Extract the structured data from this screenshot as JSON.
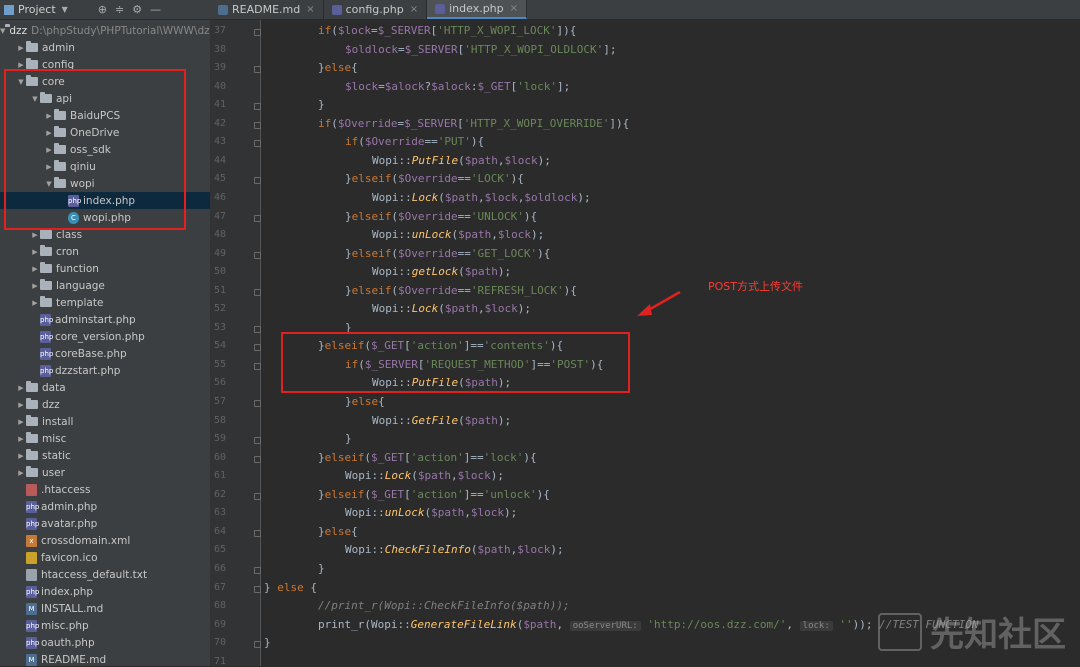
{
  "toolbar": {
    "project_label": "Project"
  },
  "tabs": [
    {
      "label": "README.md",
      "color": "#4d6e8f"
    },
    {
      "label": "config.php",
      "color": "#5a5f9a"
    },
    {
      "label": "index.php",
      "color": "#5a5f9a"
    }
  ],
  "root": {
    "name": "dzz",
    "path": "D:\\phpStudy\\PHPTutorial\\WWW\\dzz"
  },
  "tree": [
    {
      "label": "admin",
      "type": "folder",
      "depth": 1,
      "expanded": false
    },
    {
      "label": "config",
      "type": "folder",
      "depth": 1,
      "expanded": false
    },
    {
      "label": "core",
      "type": "folder",
      "depth": 1,
      "expanded": true
    },
    {
      "label": "api",
      "type": "folder",
      "depth": 2,
      "expanded": true
    },
    {
      "label": "BaiduPCS",
      "type": "folder",
      "depth": 3,
      "expanded": false
    },
    {
      "label": "OneDrive",
      "type": "folder",
      "depth": 3,
      "expanded": false
    },
    {
      "label": "oss_sdk",
      "type": "folder",
      "depth": 3,
      "expanded": false
    },
    {
      "label": "qiniu",
      "type": "folder",
      "depth": 3,
      "expanded": false
    },
    {
      "label": "wopi",
      "type": "folder",
      "depth": 3,
      "expanded": true
    },
    {
      "label": "index.php",
      "type": "php",
      "depth": 4,
      "selected": true
    },
    {
      "label": "wopi.php",
      "type": "class",
      "depth": 4
    },
    {
      "label": "class",
      "type": "folder",
      "depth": 2,
      "expanded": false
    },
    {
      "label": "cron",
      "type": "folder",
      "depth": 2,
      "expanded": false
    },
    {
      "label": "function",
      "type": "folder",
      "depth": 2,
      "expanded": false
    },
    {
      "label": "language",
      "type": "folder",
      "depth": 2,
      "expanded": false
    },
    {
      "label": "template",
      "type": "folder",
      "depth": 2,
      "expanded": false
    },
    {
      "label": "adminstart.php",
      "type": "php",
      "depth": 2
    },
    {
      "label": "core_version.php",
      "type": "php",
      "depth": 2
    },
    {
      "label": "coreBase.php",
      "type": "php",
      "depth": 2
    },
    {
      "label": "dzzstart.php",
      "type": "php",
      "depth": 2
    },
    {
      "label": "data",
      "type": "folder",
      "depth": 1,
      "expanded": false
    },
    {
      "label": "dzz",
      "type": "folder",
      "depth": 1,
      "expanded": false
    },
    {
      "label": "install",
      "type": "folder",
      "depth": 1,
      "expanded": false
    },
    {
      "label": "misc",
      "type": "folder",
      "depth": 1,
      "expanded": false
    },
    {
      "label": "static",
      "type": "folder",
      "depth": 1,
      "expanded": false
    },
    {
      "label": "user",
      "type": "folder",
      "depth": 1,
      "expanded": false
    },
    {
      "label": ".htaccess",
      "type": "ht",
      "depth": 1
    },
    {
      "label": "admin.php",
      "type": "php",
      "depth": 1
    },
    {
      "label": "avatar.php",
      "type": "php",
      "depth": 1
    },
    {
      "label": "crossdomain.xml",
      "type": "xml",
      "depth": 1
    },
    {
      "label": "favicon.ico",
      "type": "ico",
      "depth": 1
    },
    {
      "label": "htaccess_default.txt",
      "type": "txt",
      "depth": 1
    },
    {
      "label": "index.php",
      "type": "php",
      "depth": 1
    },
    {
      "label": "INSTALL.md",
      "type": "md",
      "depth": 1
    },
    {
      "label": "misc.php",
      "type": "php",
      "depth": 1
    },
    {
      "label": "oauth.php",
      "type": "php",
      "depth": 1
    },
    {
      "label": "README.md",
      "type": "md",
      "depth": 1
    }
  ],
  "code": [
    {
      "n": "37",
      "indent": 2,
      "t": [
        [
          "k",
          "if"
        ],
        [
          "p",
          "("
        ],
        [
          "v",
          "$lock"
        ],
        [
          "p",
          "="
        ],
        [
          "v",
          "$_SERVER"
        ],
        [
          "p",
          "["
        ],
        [
          "s",
          "'HTTP_X_WOPI_LOCK'"
        ],
        [
          "p",
          "]){"
        ]
      ]
    },
    {
      "n": "38",
      "indent": 3,
      "t": [
        [
          "v",
          "$oldlock"
        ],
        [
          "p",
          "="
        ],
        [
          "v",
          "$_SERVER"
        ],
        [
          "p",
          "["
        ],
        [
          "s",
          "'HTTP_X_WOPI_OLDLOCK'"
        ],
        [
          "p",
          "];"
        ]
      ]
    },
    {
      "n": "39",
      "indent": 2,
      "t": [
        [
          "p",
          "}"
        ],
        [
          "k",
          "else"
        ],
        [
          "p",
          "{"
        ]
      ]
    },
    {
      "n": "40",
      "indent": 3,
      "t": [
        [
          "v",
          "$lock"
        ],
        [
          "p",
          "="
        ],
        [
          "v",
          "$alock"
        ],
        [
          "p",
          "?"
        ],
        [
          "v",
          "$alock"
        ],
        [
          "p",
          ":"
        ],
        [
          "v",
          "$_GET"
        ],
        [
          "p",
          "["
        ],
        [
          "s",
          "'lock'"
        ],
        [
          "p",
          "];"
        ]
      ]
    },
    {
      "n": "41",
      "indent": 2,
      "t": [
        [
          "p",
          "}"
        ]
      ]
    },
    {
      "n": "42",
      "indent": 2,
      "t": [
        [
          "k",
          "if"
        ],
        [
          "p",
          "("
        ],
        [
          "v",
          "$Override"
        ],
        [
          "p",
          "="
        ],
        [
          "v",
          "$_SERVER"
        ],
        [
          "p",
          "["
        ],
        [
          "s",
          "'HTTP_X_WOPI_OVERRIDE'"
        ],
        [
          "p",
          "]){"
        ]
      ]
    },
    {
      "n": "43",
      "indent": 3,
      "t": [
        [
          "k",
          "if"
        ],
        [
          "p",
          "("
        ],
        [
          "v",
          "$Override"
        ],
        [
          "p",
          "=="
        ],
        [
          "s",
          "'PUT'"
        ],
        [
          "p",
          "){"
        ]
      ]
    },
    {
      "n": "44",
      "indent": 4,
      "t": [
        [
          "p",
          "Wopi::"
        ],
        [
          "f",
          "PutFile"
        ],
        [
          "p",
          "("
        ],
        [
          "v",
          "$path"
        ],
        [
          "p",
          ","
        ],
        [
          "v",
          "$lock"
        ],
        [
          "p",
          ");"
        ]
      ]
    },
    {
      "n": "45",
      "indent": 3,
      "t": [
        [
          "p",
          "}"
        ],
        [
          "k",
          "elseif"
        ],
        [
          "p",
          "("
        ],
        [
          "v",
          "$Override"
        ],
        [
          "p",
          "=="
        ],
        [
          "s",
          "'LOCK'"
        ],
        [
          "p",
          "){"
        ]
      ]
    },
    {
      "n": "46",
      "indent": 4,
      "t": [
        [
          "p",
          "Wopi::"
        ],
        [
          "f",
          "Lock"
        ],
        [
          "p",
          "("
        ],
        [
          "v",
          "$path"
        ],
        [
          "p",
          ","
        ],
        [
          "v",
          "$lock"
        ],
        [
          "p",
          ","
        ],
        [
          "v",
          "$oldlock"
        ],
        [
          "p",
          ");"
        ]
      ]
    },
    {
      "n": "47",
      "indent": 3,
      "t": [
        [
          "p",
          "}"
        ],
        [
          "k",
          "elseif"
        ],
        [
          "p",
          "("
        ],
        [
          "v",
          "$Override"
        ],
        [
          "p",
          "=="
        ],
        [
          "s",
          "'UNLOCK'"
        ],
        [
          "p",
          "){"
        ]
      ]
    },
    {
      "n": "48",
      "indent": 4,
      "t": [
        [
          "p",
          "Wopi::"
        ],
        [
          "f",
          "unLock"
        ],
        [
          "p",
          "("
        ],
        [
          "v",
          "$path"
        ],
        [
          "p",
          ","
        ],
        [
          "v",
          "$lock"
        ],
        [
          "p",
          ");"
        ]
      ]
    },
    {
      "n": "49",
      "indent": 3,
      "t": [
        [
          "p",
          "}"
        ],
        [
          "k",
          "elseif"
        ],
        [
          "p",
          "("
        ],
        [
          "v",
          "$Override"
        ],
        [
          "p",
          "=="
        ],
        [
          "s",
          "'GET_LOCK'"
        ],
        [
          "p",
          "){"
        ]
      ]
    },
    {
      "n": "50",
      "indent": 4,
      "t": [
        [
          "p",
          "Wopi::"
        ],
        [
          "f",
          "getLock"
        ],
        [
          "p",
          "("
        ],
        [
          "v",
          "$path"
        ],
        [
          "p",
          ");"
        ]
      ]
    },
    {
      "n": "51",
      "indent": 3,
      "t": [
        [
          "p",
          "}"
        ],
        [
          "k",
          "elseif"
        ],
        [
          "p",
          "("
        ],
        [
          "v",
          "$Override"
        ],
        [
          "p",
          "=="
        ],
        [
          "s",
          "'REFRESH_LOCK'"
        ],
        [
          "p",
          "){"
        ]
      ]
    },
    {
      "n": "52",
      "indent": 4,
      "t": [
        [
          "p",
          "Wopi::"
        ],
        [
          "f",
          "Lock"
        ],
        [
          "p",
          "("
        ],
        [
          "v",
          "$path"
        ],
        [
          "p",
          ","
        ],
        [
          "v",
          "$lock"
        ],
        [
          "p",
          ");"
        ]
      ]
    },
    {
      "n": "53",
      "indent": 3,
      "t": [
        [
          "p",
          "}"
        ]
      ]
    },
    {
      "n": "54",
      "indent": 2,
      "t": [
        [
          "p",
          "}"
        ],
        [
          "k",
          "elseif"
        ],
        [
          "p",
          "("
        ],
        [
          "v",
          "$_GET"
        ],
        [
          "p",
          "["
        ],
        [
          "s",
          "'action'"
        ],
        [
          "p",
          "]=="
        ],
        [
          "s",
          "'contents'"
        ],
        [
          "p",
          "){"
        ]
      ]
    },
    {
      "n": "55",
      "indent": 3,
      "t": [
        [
          "k",
          "if"
        ],
        [
          "p",
          "("
        ],
        [
          "v",
          "$_SERVER"
        ],
        [
          "p",
          "["
        ],
        [
          "s",
          "'REQUEST_METHOD'"
        ],
        [
          "p",
          "]=="
        ],
        [
          "s",
          "'POST'"
        ],
        [
          "p",
          "){"
        ]
      ]
    },
    {
      "n": "56",
      "indent": 4,
      "t": [
        [
          "p",
          "Wopi::"
        ],
        [
          "f",
          "PutFile"
        ],
        [
          "p",
          "("
        ],
        [
          "v",
          "$path"
        ],
        [
          "p",
          ");"
        ]
      ]
    },
    {
      "n": "57",
      "indent": 3,
      "t": [
        [
          "p",
          "}"
        ],
        [
          "k",
          "else"
        ],
        [
          "p",
          "{"
        ]
      ]
    },
    {
      "n": "58",
      "indent": 4,
      "t": [
        [
          "p",
          "Wopi::"
        ],
        [
          "f",
          "GetFile"
        ],
        [
          "p",
          "("
        ],
        [
          "v",
          "$path"
        ],
        [
          "p",
          ");"
        ]
      ]
    },
    {
      "n": "59",
      "indent": 3,
      "t": [
        [
          "p",
          "}"
        ]
      ]
    },
    {
      "n": "60",
      "indent": 2,
      "t": [
        [
          "p",
          "}"
        ],
        [
          "k",
          "elseif"
        ],
        [
          "p",
          "("
        ],
        [
          "v",
          "$_GET"
        ],
        [
          "p",
          "["
        ],
        [
          "s",
          "'action'"
        ],
        [
          "p",
          "]=="
        ],
        [
          "s",
          "'lock'"
        ],
        [
          "p",
          "){"
        ]
      ]
    },
    {
      "n": "61",
      "indent": 3,
      "t": [
        [
          "p",
          "Wopi::"
        ],
        [
          "f",
          "Lock"
        ],
        [
          "p",
          "("
        ],
        [
          "v",
          "$path"
        ],
        [
          "p",
          ","
        ],
        [
          "v",
          "$lock"
        ],
        [
          "p",
          ");"
        ]
      ]
    },
    {
      "n": "62",
      "indent": 2,
      "t": [
        [
          "p",
          "}"
        ],
        [
          "k",
          "elseif"
        ],
        [
          "p",
          "("
        ],
        [
          "v",
          "$_GET"
        ],
        [
          "p",
          "["
        ],
        [
          "s",
          "'action'"
        ],
        [
          "p",
          "]=="
        ],
        [
          "s",
          "'unlock'"
        ],
        [
          "p",
          "){"
        ]
      ]
    },
    {
      "n": "63",
      "indent": 3,
      "t": [
        [
          "p",
          "Wopi::"
        ],
        [
          "f",
          "unLock"
        ],
        [
          "p",
          "("
        ],
        [
          "v",
          "$path"
        ],
        [
          "p",
          ","
        ],
        [
          "v",
          "$lock"
        ],
        [
          "p",
          ");"
        ]
      ]
    },
    {
      "n": "64",
      "indent": 2,
      "t": [
        [
          "p",
          "}"
        ],
        [
          "k",
          "else"
        ],
        [
          "p",
          "{"
        ]
      ]
    },
    {
      "n": "65",
      "indent": 3,
      "t": [
        [
          "p",
          "Wopi::"
        ],
        [
          "f",
          "CheckFileInfo"
        ],
        [
          "p",
          "("
        ],
        [
          "v",
          "$path"
        ],
        [
          "p",
          ","
        ],
        [
          "v",
          "$lock"
        ],
        [
          "p",
          ");"
        ]
      ]
    },
    {
      "n": "66",
      "indent": 2,
      "t": [
        [
          "p",
          "}"
        ]
      ]
    },
    {
      "n": "67",
      "indent": 0,
      "t": [
        [
          "p",
          "} "
        ],
        [
          "k",
          "else"
        ],
        [
          "p",
          " {"
        ]
      ]
    },
    {
      "n": "68",
      "indent": 2,
      "t": [
        [
          "c",
          "//print_r(Wopi::CheckFileInfo($path));"
        ]
      ]
    },
    {
      "n": "69",
      "indent": 2,
      "t": [
        [
          "p",
          "print_r(Wopi::"
        ],
        [
          "f",
          "GenerateFileLink"
        ],
        [
          "p",
          "("
        ],
        [
          "v",
          "$path"
        ],
        [
          "p",
          ", "
        ],
        [
          "h",
          "ooServerURL:"
        ],
        [
          "p",
          " "
        ],
        [
          "s",
          "'http://oos.dzz.com/'"
        ],
        [
          "p",
          ", "
        ],
        [
          "h",
          "lock:"
        ],
        [
          "p",
          " "
        ],
        [
          "s",
          "''"
        ],
        [
          "p",
          "));"
        ],
        [
          "c",
          " //TEST FUNCTION"
        ]
      ]
    },
    {
      "n": "70",
      "indent": 0,
      "t": [
        [
          "p",
          "}"
        ]
      ]
    },
    {
      "n": "71",
      "indent": 0,
      "t": []
    }
  ],
  "annotation": "POST方式上传文件",
  "watermark": "先知社区"
}
